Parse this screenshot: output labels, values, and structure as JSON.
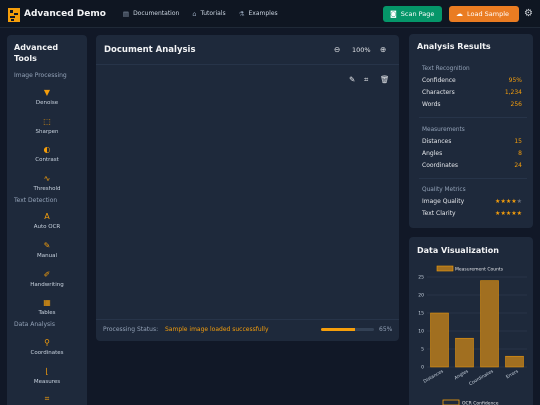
{
  "header": {
    "title": "Advanced Demo",
    "nav": [
      {
        "label": "Documentation",
        "icon": "book-icon"
      },
      {
        "label": "Tutorials",
        "icon": "graduation-cap-icon"
      },
      {
        "label": "Examples",
        "icon": "flask-icon"
      }
    ],
    "scan_label": "Scan Page",
    "load_label": "Load Sample"
  },
  "sidebar": {
    "title": "Advanced Tools",
    "sections": [
      "Image Processing",
      "Text Detection",
      "Data Analysis"
    ],
    "items": [
      {
        "label": "Denoise",
        "icon": "denoise-icon"
      },
      {
        "label": "Sharpen",
        "icon": "sharpen-icon"
      },
      {
        "label": "Contrast",
        "icon": "contrast-icon"
      },
      {
        "label": "Threshold",
        "icon": "threshold-icon"
      },
      {
        "label": "Auto OCR",
        "icon": "auto-ocr-icon"
      },
      {
        "label": "Manual",
        "icon": "hand-icon"
      },
      {
        "label": "Handwriting",
        "icon": "pen-icon"
      },
      {
        "label": "Tables",
        "icon": "table-icon"
      },
      {
        "label": "Coordinates",
        "icon": "map-pin-icon"
      },
      {
        "label": "Measures",
        "icon": "ruler-icon"
      },
      {
        "label": "",
        "icon": "crop-icon"
      }
    ]
  },
  "document": {
    "title": "Document Analysis",
    "zoom": "100%",
    "status_label": "Processing Status:",
    "status_text": "Sample image loaded successfully",
    "progress": 65,
    "progress_text": "65%"
  },
  "results": {
    "title": "Analysis Results",
    "text_recognition": {
      "heading": "Text Recognition",
      "rows": [
        {
          "label": "Confidence",
          "value": "95%"
        },
        {
          "label": "Characters",
          "value": "1,234"
        },
        {
          "label": "Words",
          "value": "256"
        }
      ]
    },
    "measurements": {
      "heading": "Measurements",
      "rows": [
        {
          "label": "Distances",
          "value": "15"
        },
        {
          "label": "Angles",
          "value": "8"
        },
        {
          "label": "Coordinates",
          "value": "24"
        }
      ]
    },
    "quality": {
      "heading": "Quality Metrics",
      "rows": [
        {
          "label": "Image Quality",
          "stars": 4,
          "of": 5
        },
        {
          "label": "Text Clarity",
          "stars": 5,
          "of": 5
        }
      ]
    }
  },
  "viz": {
    "title": "Data Visualization"
  },
  "colors": {
    "accent": "#f59e0b",
    "scan": "#059669",
    "load": "#ea7c22",
    "bar": "#a16f20"
  },
  "chart_data": {
    "type": "bar",
    "categories": [
      "Distances",
      "Angles",
      "Coordinates",
      "Errors"
    ],
    "series": [
      {
        "name": "Measurement Counts",
        "values": [
          15,
          8,
          24,
          3
        ]
      },
      {
        "name": "OCR Confidence",
        "values": []
      }
    ],
    "ylim": [
      0,
      25
    ],
    "yticks": [
      0,
      5,
      10,
      15,
      20,
      25
    ],
    "legend": "top",
    "grid": true
  }
}
